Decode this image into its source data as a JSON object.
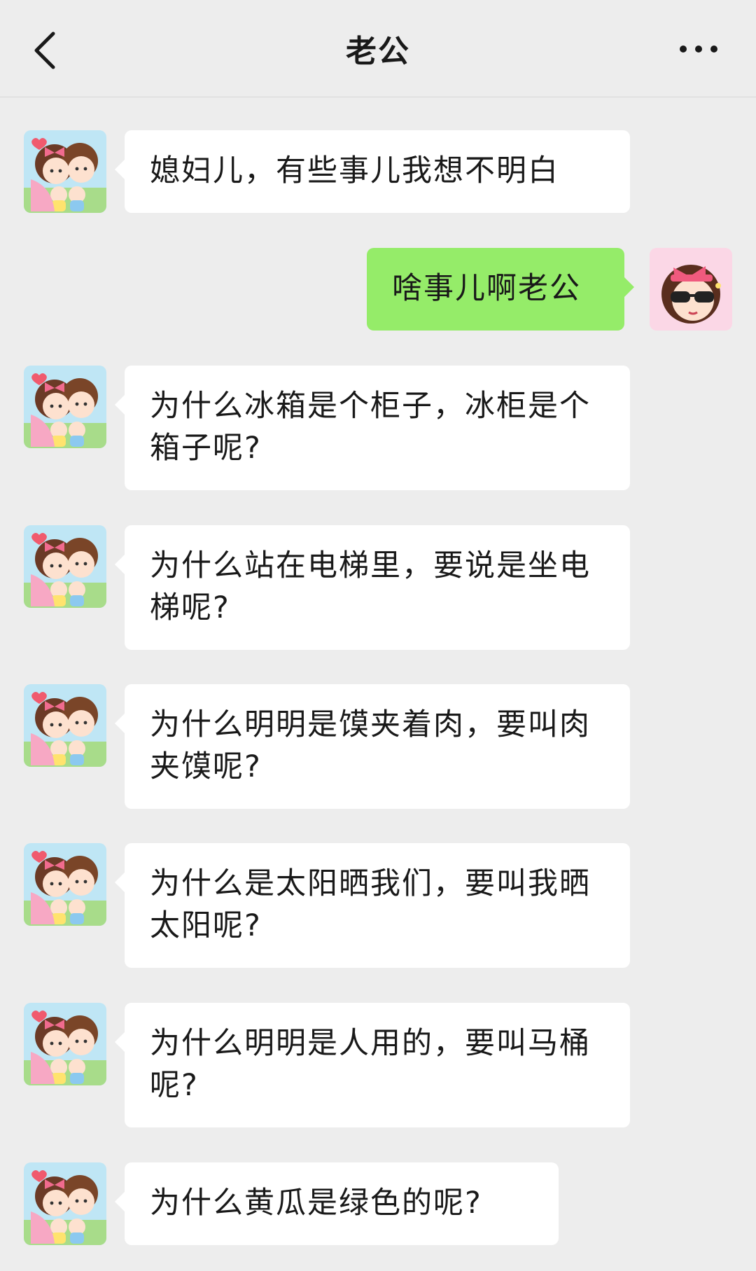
{
  "header": {
    "title": "老公",
    "back_icon": "chevron-left-icon",
    "more_icon": "more-dots-icon"
  },
  "colors": {
    "background": "#ededed",
    "incoming_bubble": "#ffffff",
    "outgoing_bubble": "#95ec69"
  },
  "messages": [
    {
      "sender": "husband",
      "text": "媳妇儿，有些事儿我想不明白"
    },
    {
      "sender": "me",
      "text": "啥事儿啊老公"
    },
    {
      "sender": "husband",
      "text": "为什么冰箱是个柜子，冰柜是个箱子呢?"
    },
    {
      "sender": "husband",
      "text": "为什么站在电梯里，要说是坐电梯呢?"
    },
    {
      "sender": "husband",
      "text": "为什么明明是馍夹着肉，要叫肉夹馍呢?"
    },
    {
      "sender": "husband",
      "text": "为什么是太阳晒我们，要叫我晒太阳呢?"
    },
    {
      "sender": "husband",
      "text": "为什么明明是人用的，要叫马桶呢?"
    },
    {
      "sender": "husband",
      "text": "为什么黄瓜是绿色的呢?"
    }
  ]
}
